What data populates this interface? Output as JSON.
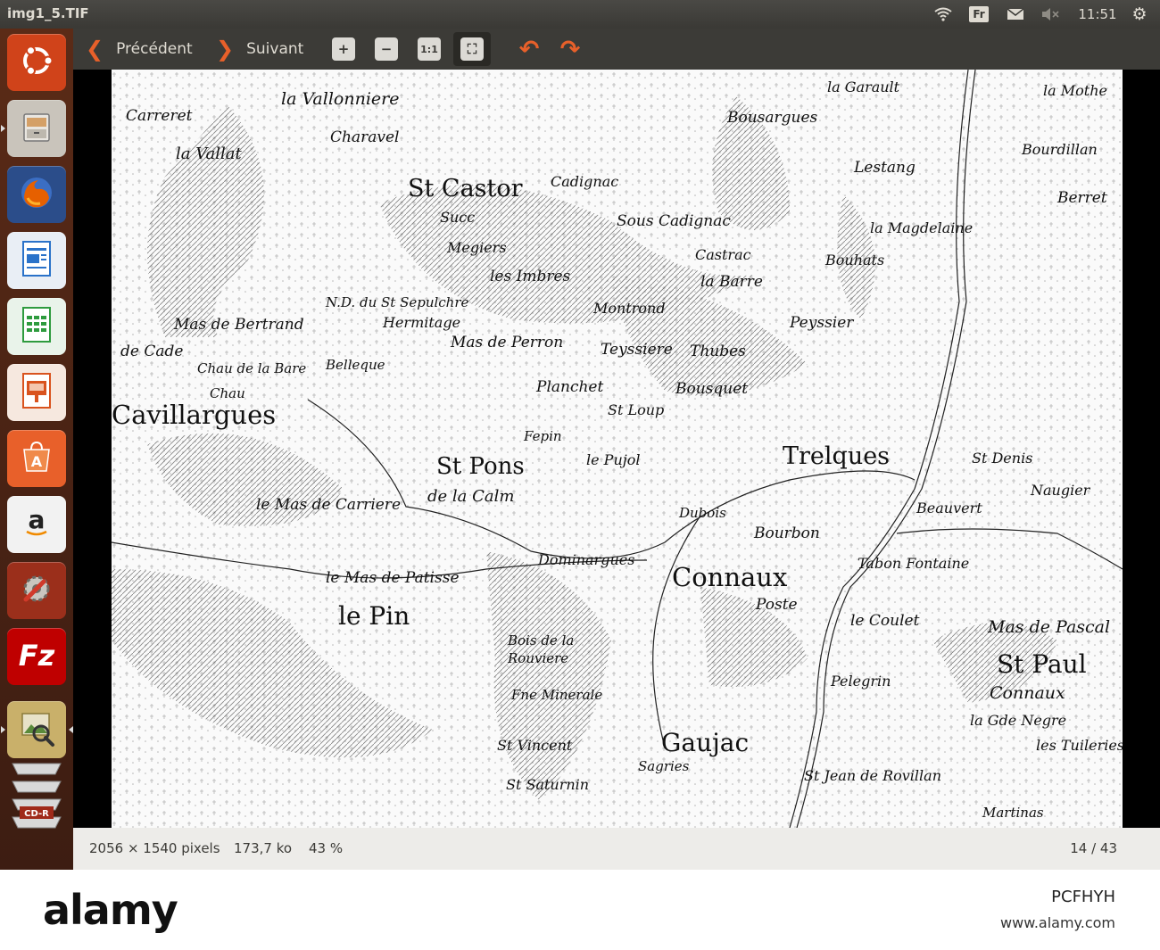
{
  "panel": {
    "window_title": "img1_5.TIF",
    "indicators": {
      "wifi": "wifi-icon",
      "language": "Fr",
      "mail": "mail-icon",
      "sound": "sound-muted-icon",
      "clock": "11:51",
      "session": "gear-icon"
    }
  },
  "launcher": {
    "items": [
      {
        "name": "ubuntu-dash",
        "icon": "ubuntu-icon",
        "color": "#d0431a"
      },
      {
        "name": "files",
        "icon": "cabinet-icon",
        "color": "#c9c4bb"
      },
      {
        "name": "firefox",
        "icon": "firefox-icon",
        "color": "#e66000"
      },
      {
        "name": "writer",
        "icon": "writer-icon",
        "color": "#2a72c9"
      },
      {
        "name": "calc",
        "icon": "calc-icon",
        "color": "#2e9b3e"
      },
      {
        "name": "impress",
        "icon": "impress-icon",
        "color": "#d9531e"
      },
      {
        "name": "software-center",
        "icon": "software-center-icon",
        "color": "#e8602a"
      },
      {
        "name": "amazon",
        "icon": "amazon-icon",
        "color": "#f2f2f2"
      },
      {
        "name": "system-settings",
        "icon": "settings-icon",
        "color": "#9b2f1b"
      },
      {
        "name": "filezilla",
        "icon": "filezilla-icon",
        "color": "#bf0000"
      },
      {
        "name": "image-viewer",
        "icon": "image-viewer-icon",
        "color": "#c9b06a"
      },
      {
        "name": "disc-drive",
        "icon": "disc-icon",
        "color": "#cfcfcf"
      }
    ],
    "cd_label": "CD-R"
  },
  "toolbar": {
    "prev_label": "Précédent",
    "next_label": "Suivant",
    "zoom_in": "+",
    "zoom_out": "−",
    "zoom_normal": "1:1",
    "zoom_fit": "⛶",
    "rotate_left": "↶",
    "rotate_right": "↷"
  },
  "map": {
    "labels": [
      "la Vallonniere",
      "Carreret",
      "Charavel",
      "la Vallat",
      "St Castor",
      "Succ",
      "Megiers",
      "les Imbres",
      "Cadignac",
      "Sous Cadignac",
      "Castrac",
      "la Barre",
      "la Garault",
      "Bousargues",
      "Lestang",
      "la Magdelaine",
      "Bouhats",
      "la Mothe",
      "Bourdillan",
      "Berret",
      "N.D. du St Sepulchre",
      "Hermitage",
      "Mas de Bertrand",
      "Mas de Perron",
      "Montrond",
      "Teyssiere",
      "Thubes",
      "Peyssier",
      "de Cade",
      "Chau de la Bare",
      "Belleque",
      "Planchet",
      "St Loup",
      "Bousquet",
      "Cavillargues",
      "St Pons",
      "de la Calm",
      "le Pujol",
      "Trelques",
      "Beauvert",
      "Bourbon",
      "St Denis",
      "Naugier",
      "le Mas de Carriere",
      "Dominargues",
      "Connaux",
      "Poste",
      "Tabon Fontaine",
      "le Mas de Patisse",
      "le Pin",
      "le Coulet",
      "Mas de Pascal",
      "St Paul",
      "Connaux",
      "Bois de la Rouviere",
      "Fne Minerale",
      "St Vincent",
      "Gaujac",
      "Pelegrin",
      "la Gde Negre",
      "les Tuileries",
      "St Saturnin",
      "Sagries",
      "St Jean de Rovillan",
      "Martinas",
      "Fepin",
      "Dubois",
      "Chau"
    ]
  },
  "status": {
    "dimensions": "2056 × 1540 pixels",
    "filesize": "173,7 ko",
    "zoom": "43 %",
    "page": "14 / 43"
  },
  "watermark": {
    "logo": "alamy",
    "image_id": "PCFHYH",
    "url": "www.alamy.com"
  }
}
